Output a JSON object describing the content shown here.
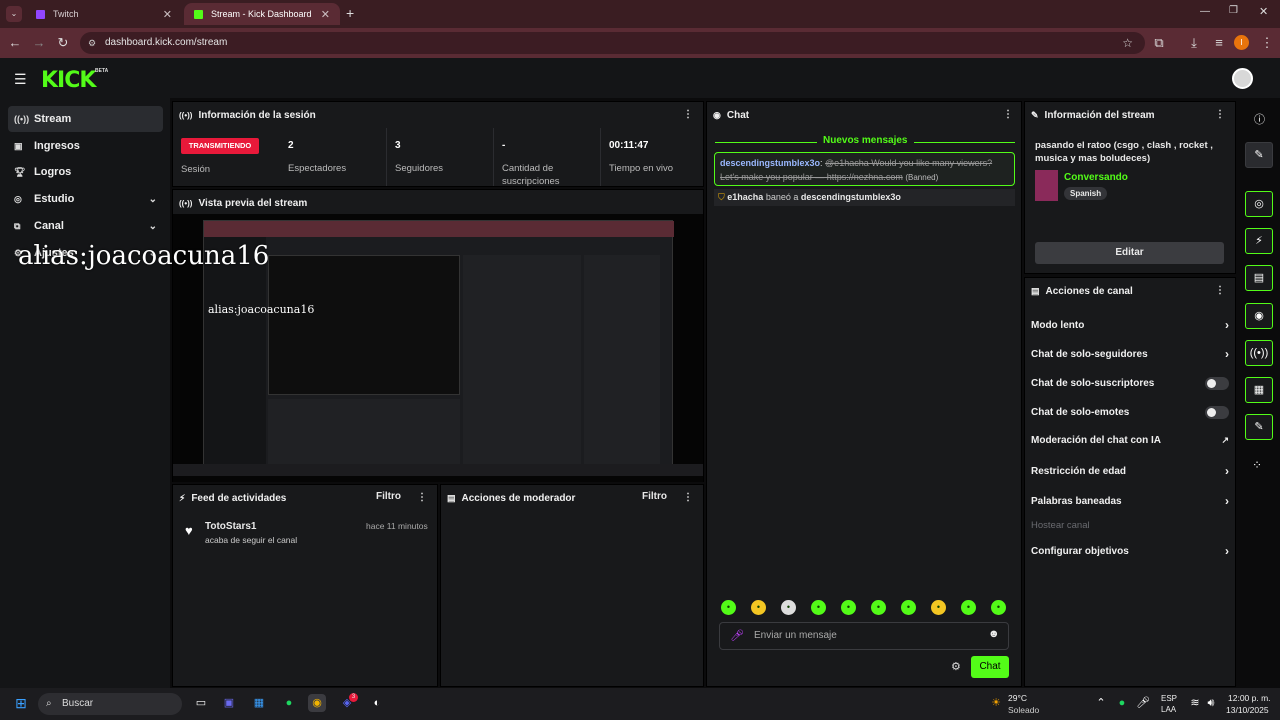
{
  "browser": {
    "tabs": [
      {
        "label": "Twitch"
      },
      {
        "label": "Stream - Kick Dashboard"
      }
    ],
    "url": "dashboard.kick.com/stream",
    "profile_initial": "I"
  },
  "app": {
    "logo": "KICK",
    "beta": "BETA"
  },
  "sidebar": {
    "items": [
      {
        "label": "Stream",
        "icon": "broadcast-icon"
      },
      {
        "label": "Ingresos",
        "icon": "wallet-icon"
      },
      {
        "label": "Logros",
        "icon": "trophy-icon"
      },
      {
        "label": "Estudio",
        "icon": "studio-icon"
      },
      {
        "label": "Canal",
        "icon": "channel-icon"
      },
      {
        "label": "Ajustes",
        "icon": "gear-icon"
      }
    ]
  },
  "overlay_text": "alias:joacoacuna16",
  "session": {
    "title": "Información de la sesión",
    "status": "TRANSMITIENDO",
    "status_label": "Sesión",
    "stats": [
      {
        "value": "2",
        "label": "Espectadores"
      },
      {
        "value": "3",
        "label": "Seguidores"
      },
      {
        "value": "-",
        "label": "Cantidad de suscripciones"
      },
      {
        "value": "00:11:47",
        "label": "Tiempo en vivo"
      }
    ]
  },
  "preview": {
    "title": "Vista previa del stream"
  },
  "feed": {
    "title": "Feed de actividades",
    "filter": "Filtro",
    "item": {
      "user": "TotoStars1",
      "action": "acaba de seguir el canal",
      "time": "hace 11 minutos"
    }
  },
  "mod": {
    "title": "Acciones de moderador",
    "filter": "Filtro"
  },
  "chat": {
    "title": "Chat",
    "new_messages": "Nuevos mensajes",
    "msg_user": "descendingstumblex3o",
    "msg_text": "@e1hacha Would you like many viewers? Let's make you popular — https://nezhna.com",
    "msg_tag": "(Banned)",
    "ban_user": "e1hacha",
    "ban_text": "baneó a",
    "ban_target": "descendingstumblex3o",
    "input_placeholder": "Enviar un mensaje",
    "send": "Chat"
  },
  "stream_info": {
    "title": "Información del stream",
    "stream_title": "pasando el ratoo (csgo , clash , rocket , musica y mas boludeces)",
    "category": "Conversando",
    "language": "Spanish",
    "edit": "Editar"
  },
  "channel_actions": {
    "title": "Acciones de canal",
    "items": [
      {
        "label": "Modo lento",
        "control": "chevron"
      },
      {
        "label": "Chat de solo-seguidores",
        "control": "chevron"
      },
      {
        "label": "Chat de solo-suscriptores",
        "control": "toggle"
      },
      {
        "label": "Chat de solo-emotes",
        "control": "toggle"
      },
      {
        "label": "Moderación del chat con IA",
        "control": "external"
      },
      {
        "label": "Restricción de edad",
        "control": "chevron"
      },
      {
        "label": "Palabras baneadas",
        "control": "chevron"
      },
      {
        "label": "Hostear canal",
        "control": "disabled"
      },
      {
        "label": "Configurar objetivos",
        "control": "chevron"
      }
    ]
  },
  "taskbar": {
    "search": "Buscar",
    "weather_temp": "29°C",
    "weather_desc": "Soleado",
    "lang1": "ESP",
    "lang2": "LAA",
    "time": "12:00 p. m.",
    "date": "13/10/2025",
    "discord_badge": "3"
  },
  "colors": {
    "accent": "#53fc18",
    "live": "#e8193a",
    "chrome": "#5a2b34"
  }
}
